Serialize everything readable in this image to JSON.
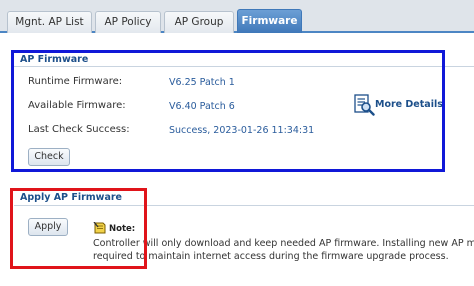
{
  "tabs": [
    {
      "label": "Mgnt. AP List",
      "active": false
    },
    {
      "label": "AP Policy",
      "active": false
    },
    {
      "label": "AP Group",
      "active": false
    },
    {
      "label": "Firmware",
      "active": true
    }
  ],
  "ap_firmware": {
    "title": "AP Firmware",
    "runtime_label": "Runtime Firmware:",
    "runtime_value": "V6.25 Patch 1",
    "available_label": "Available Firmware:",
    "available_value": "V6.40 Patch 6",
    "last_check_label": "Last Check Success:",
    "last_check_value": "Success, 2023-01-26 11:34:31",
    "check_button": "Check",
    "more_details": "More Details",
    "more_details_icon": "document-magnifier-icon"
  },
  "apply_ap_firmware": {
    "title": "Apply AP Firmware",
    "apply_button": "Apply",
    "note_label": "Note:",
    "note_icon": "note-pin-icon",
    "note_line1": "Controller will only download and keep needed AP firmware. Installing new AP may",
    "note_line2": "required to maintain internet access during the firmware upgrade process."
  },
  "highlights": {
    "ap_firmware_box_color": "#1018d8",
    "apply_box_color": "#e0141a"
  }
}
